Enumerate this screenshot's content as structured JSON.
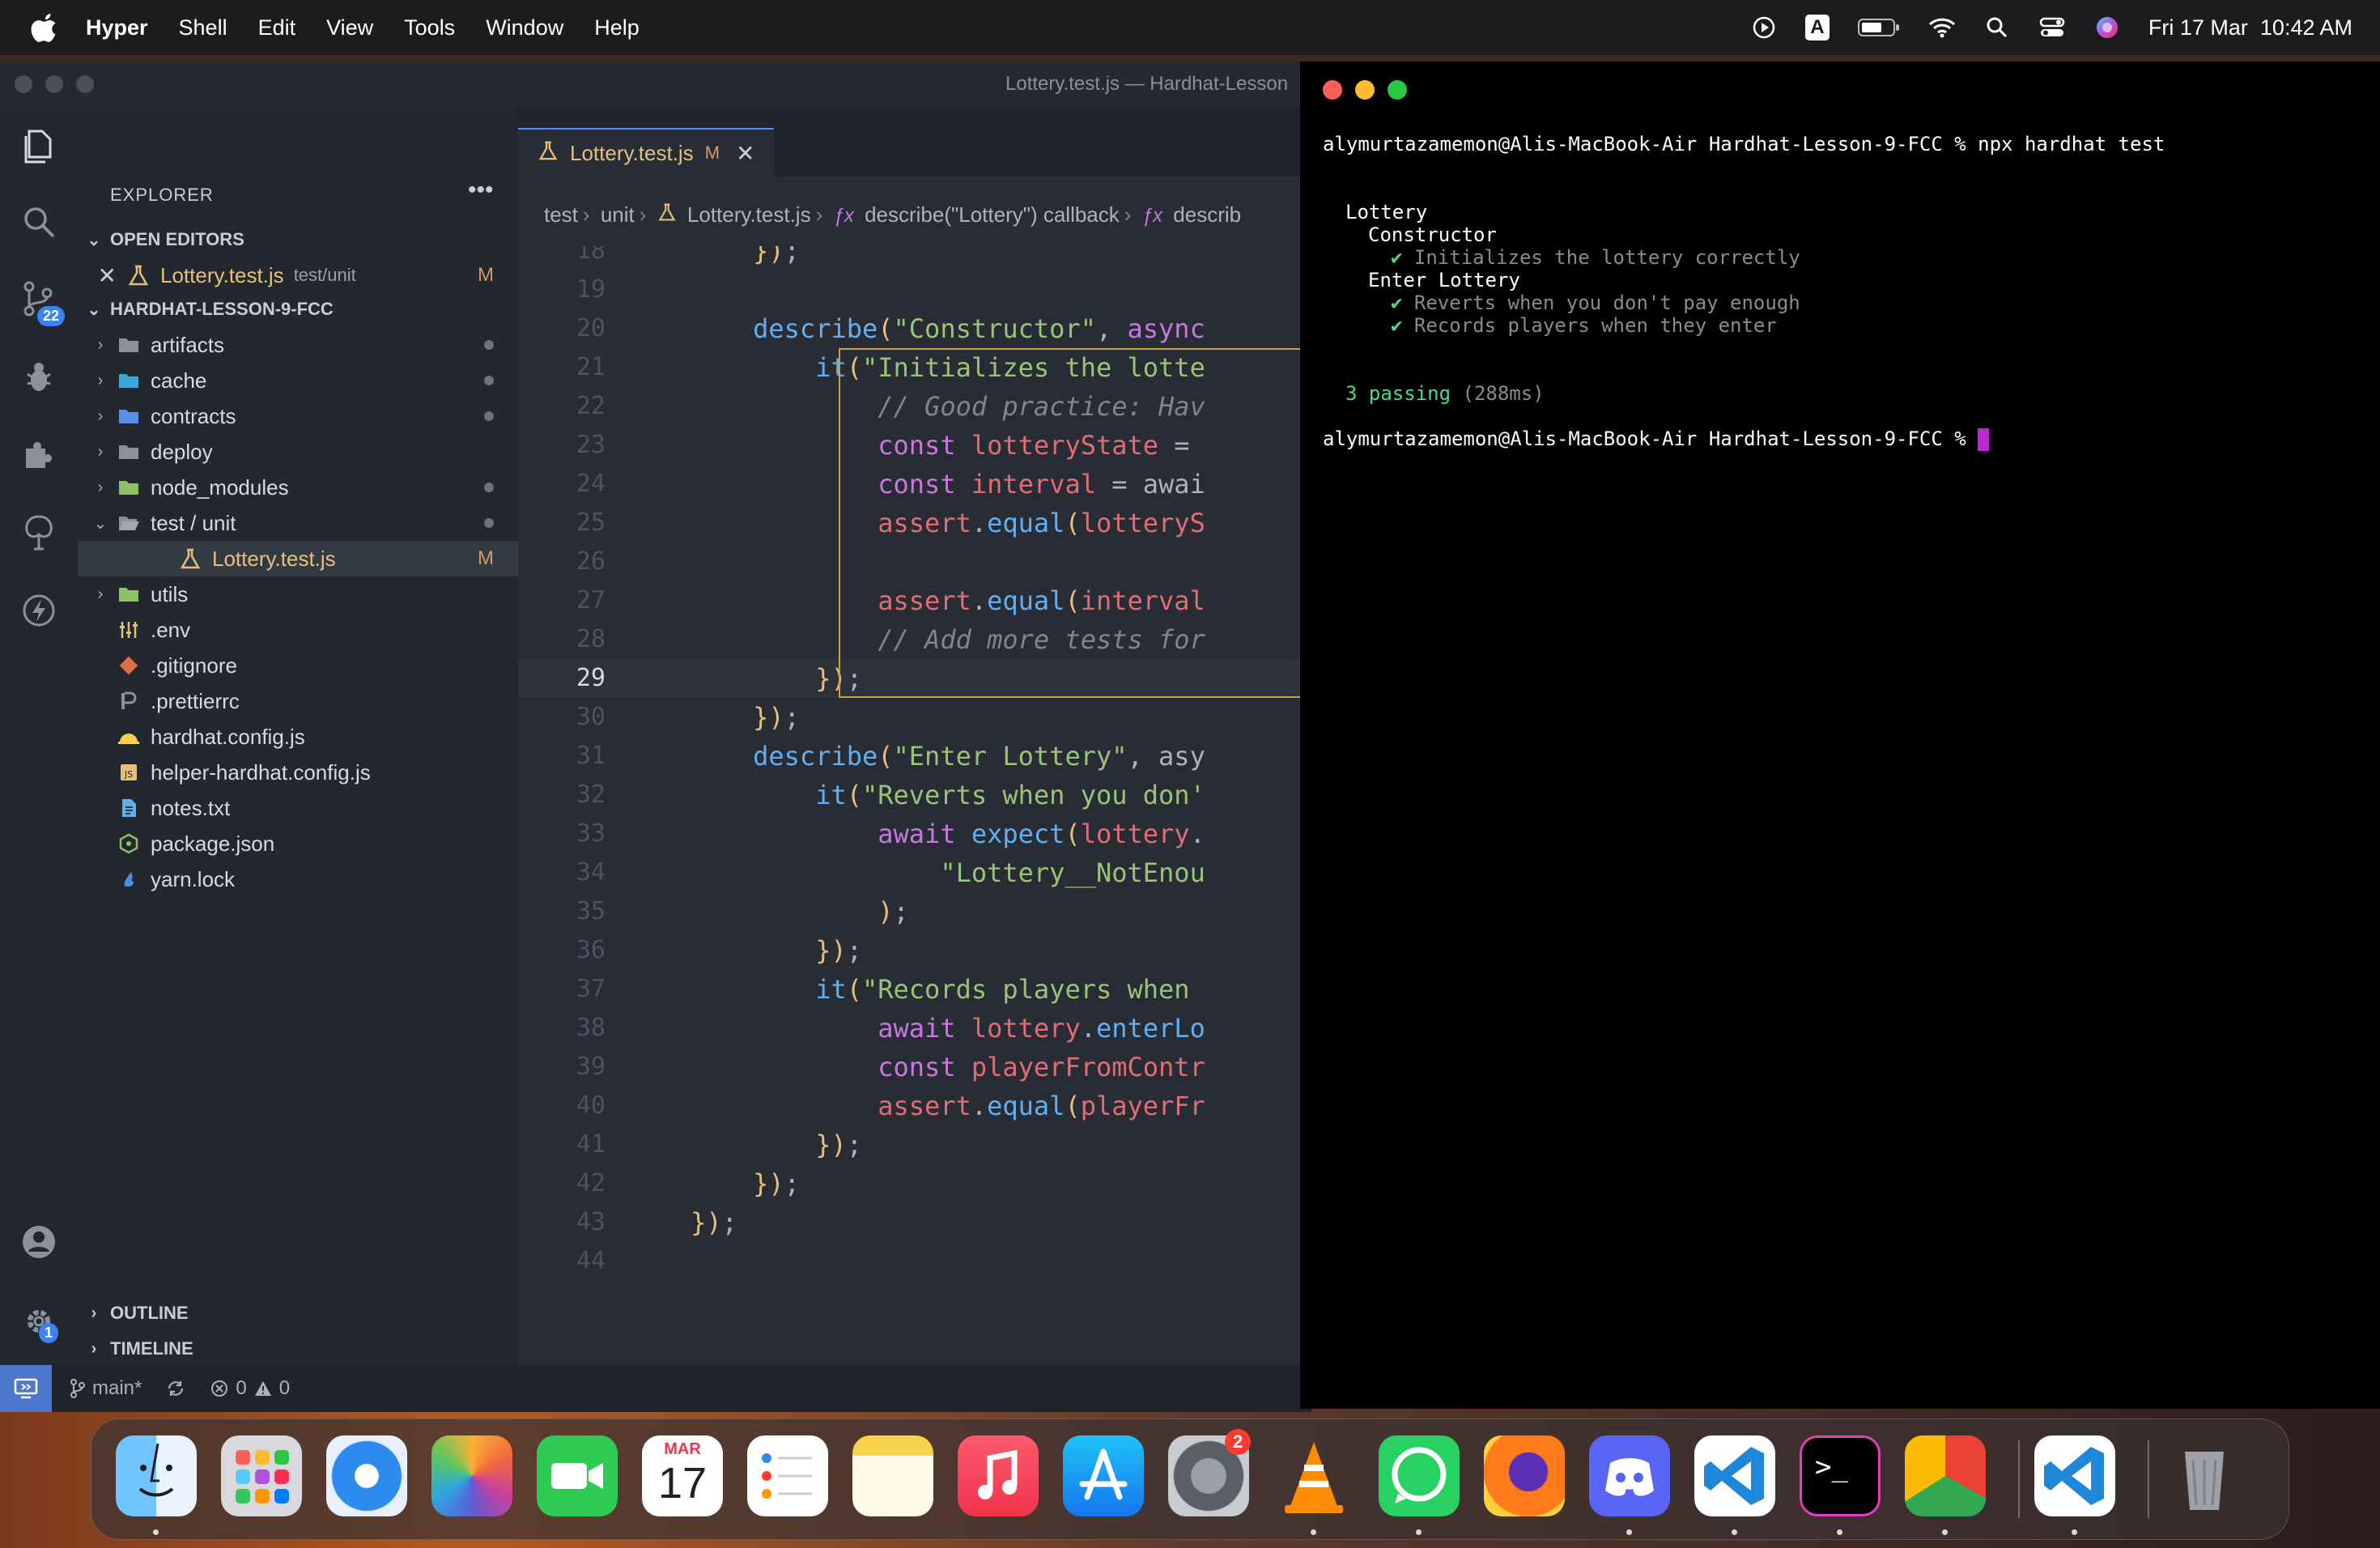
{
  "menubar": {
    "app_name": "Hyper",
    "menus": [
      "Shell",
      "Edit",
      "View",
      "Tools",
      "Window",
      "Help"
    ],
    "clock": "Fri 17 Mar  10:42 AM",
    "input_source": "A"
  },
  "vscode": {
    "window_title": "Lottery.test.js — Hardhat-Lesson",
    "explorer_title": "EXPLORER",
    "open_editors": {
      "header": "OPEN EDITORS",
      "items": [
        {
          "name": "Lottery.test.js",
          "path": "test/unit",
          "status": "M"
        }
      ]
    },
    "project": {
      "header": "HARDHAT-LESSON-9-FCC",
      "rows": [
        {
          "name": "artifacts",
          "kind": "folder",
          "dot": true
        },
        {
          "name": "cache",
          "kind": "folder",
          "dot": true
        },
        {
          "name": "contracts",
          "kind": "folder",
          "dot": true
        },
        {
          "name": "deploy",
          "kind": "folder",
          "dot": false
        },
        {
          "name": "node_modules",
          "kind": "folder",
          "dot": true
        },
        {
          "name": "test / unit",
          "kind": "folder-open",
          "dot": true
        },
        {
          "name": "Lottery.test.js",
          "kind": "test-file",
          "status": "M"
        },
        {
          "name": "utils",
          "kind": "folder",
          "dot": false
        },
        {
          "name": ".env",
          "kind": "env",
          "dot": false
        },
        {
          "name": ".gitignore",
          "kind": "git",
          "dot": false
        },
        {
          "name": ".prettierrc",
          "kind": "prettier",
          "dot": false
        },
        {
          "name": "hardhat.config.js",
          "kind": "hardhat",
          "dot": false
        },
        {
          "name": "helper-hardhat.config.js",
          "kind": "js",
          "dot": false
        },
        {
          "name": "notes.txt",
          "kind": "txt",
          "dot": false
        },
        {
          "name": "package.json",
          "kind": "json",
          "dot": false
        },
        {
          "name": "yarn.lock",
          "kind": "yarn",
          "dot": false
        }
      ]
    },
    "outline_header": "OUTLINE",
    "timeline_header": "TIMELINE",
    "source_control_badge": "22",
    "settings_badge": "1",
    "tab": {
      "name": "Lottery.test.js",
      "status": "M"
    },
    "breadcrumb": [
      "test",
      "unit",
      "Lottery.test.js",
      "describe(\"Lottery\") callback",
      "describ"
    ],
    "current_line": "29",
    "code_lines": [
      {
        "n": "18",
        "text": "        });"
      },
      {
        "n": "19",
        "text": ""
      },
      {
        "n": "20",
        "text": "        describe(\"Constructor\", async"
      },
      {
        "n": "21",
        "text": "            it(\"Initializes the lotte"
      },
      {
        "n": "22",
        "text": "                // Good practice: Hav"
      },
      {
        "n": "23",
        "text": "                const lotteryState ="
      },
      {
        "n": "24",
        "text": "                const interval = awai"
      },
      {
        "n": "25",
        "text": "                assert.equal(lotteryS"
      },
      {
        "n": "26",
        "text": ""
      },
      {
        "n": "27",
        "text": "                assert.equal(interval"
      },
      {
        "n": "28",
        "text": "                // Add more tests for"
      },
      {
        "n": "29",
        "text": "            });"
      },
      {
        "n": "30",
        "text": "        });"
      },
      {
        "n": "31",
        "text": "        describe(\"Enter Lottery\", asy"
      },
      {
        "n": "32",
        "text": "            it(\"Reverts when you don'"
      },
      {
        "n": "33",
        "text": "                await expect(lottery."
      },
      {
        "n": "34",
        "text": "                    \"Lottery__NotEnou"
      },
      {
        "n": "35",
        "text": "                );"
      },
      {
        "n": "36",
        "text": "            });"
      },
      {
        "n": "37",
        "text": "            it(\"Records players when"
      },
      {
        "n": "38",
        "text": "                await lottery.enterLo"
      },
      {
        "n": "39",
        "text": "                const playerFromContr"
      },
      {
        "n": "40",
        "text": "                assert.equal(playerFr"
      },
      {
        "n": "41",
        "text": "            });"
      },
      {
        "n": "42",
        "text": "        });"
      },
      {
        "n": "43",
        "text": "    });"
      },
      {
        "n": "44",
        "text": ""
      }
    ],
    "status": {
      "branch": "main*",
      "errors": "0",
      "warnings": "0"
    }
  },
  "terminal": {
    "prompt1": "alymurtazamemon@Alis-MacBook-Air Hardhat-Lesson-9-FCC % npx hardhat test",
    "suite": "Lottery",
    "group1": "Constructor",
    "test1": "Initializes the lottery correctly",
    "group2": "Enter Lottery",
    "test2": "Reverts when you don't pay enough",
    "test3": "Records players when they enter",
    "check": "✔",
    "passing": "3 passing",
    "duration": "(288ms)",
    "prompt2": "alymurtazamemon@Alis-MacBook-Air Hardhat-Lesson-9-FCC %"
  },
  "dock": {
    "calendar_month": "MAR",
    "calendar_day": "17",
    "settings_badge": "2",
    "apps": [
      "Finder",
      "Launchpad",
      "Safari",
      "Photos",
      "FaceTime",
      "Calendar",
      "Reminders",
      "Notes",
      "Music",
      "App Store",
      "System Settings",
      "VLC",
      "WhatsApp",
      "Firefox",
      "Discord",
      "Visual Studio Code",
      "Hyper",
      "Chrome",
      "Visual Studio Code",
      "Trash"
    ]
  }
}
